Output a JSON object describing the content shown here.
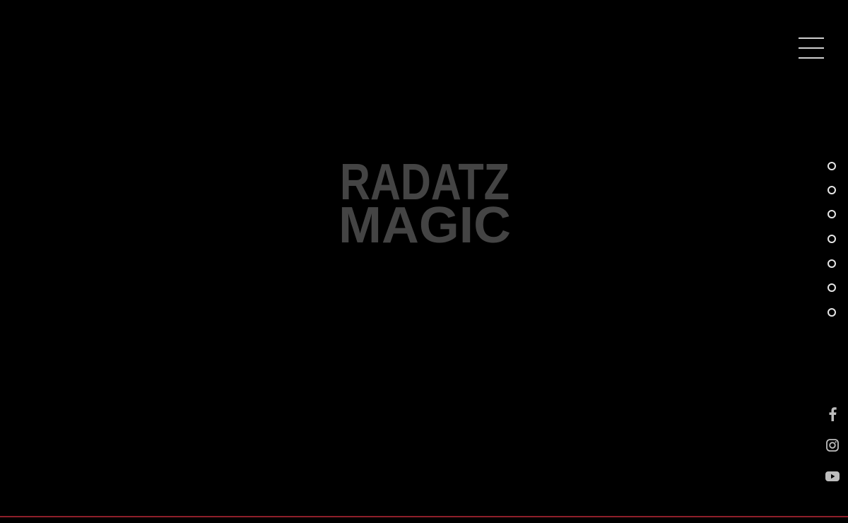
{
  "logo": {
    "line1": "RADATZ",
    "line2": "MAGIC",
    "color": "#444444"
  },
  "header": {
    "menu_icon": "hamburger-icon"
  },
  "section_nav": {
    "dot_icon": "circle-outline-icon",
    "count": 7
  },
  "social": {
    "icons": [
      "facebook-icon",
      "instagram-icon",
      "youtube-icon"
    ],
    "color": "#bdbdbd"
  },
  "colors": {
    "background": "#000000",
    "accent_line": "#8e1f2a",
    "dot": "#e6e6e6",
    "menu": "#cfcfcf"
  }
}
